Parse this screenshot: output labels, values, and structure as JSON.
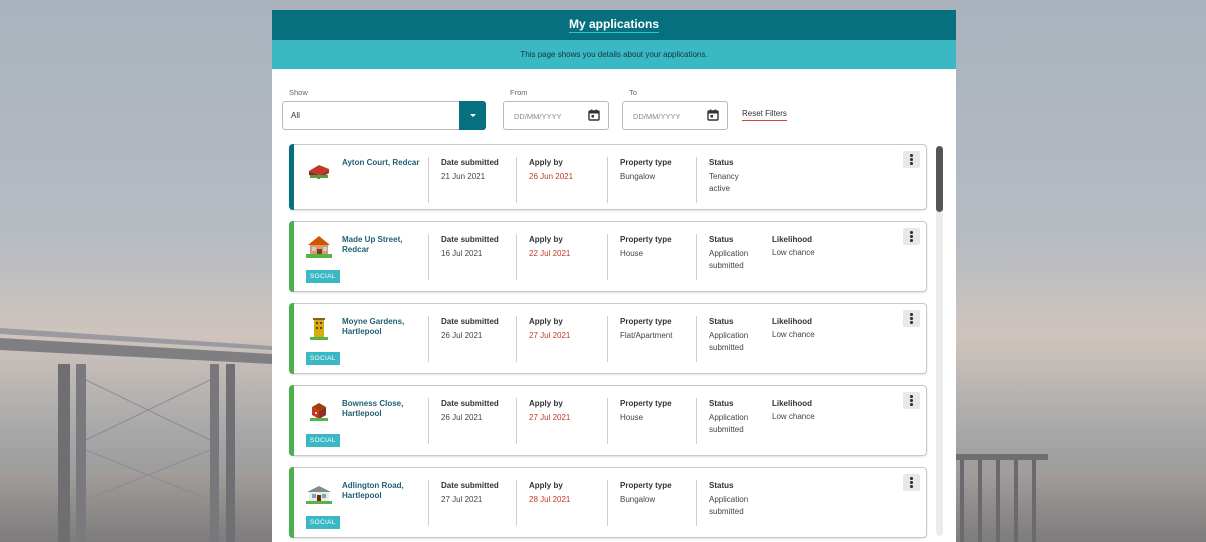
{
  "header": {
    "title": "My applications"
  },
  "subheader": {
    "text": "This page shows you details about your applications."
  },
  "filters": {
    "show_label": "Show",
    "show_value": "All",
    "from_label": "From",
    "from_placeholder": "DD/MM/YYYY",
    "to_label": "To",
    "to_placeholder": "DD/MM/YYYY",
    "reset_label": "Reset Filters"
  },
  "labels": {
    "date_submitted": "Date submitted",
    "apply_by": "Apply by",
    "property_type": "Property type",
    "status": "Status",
    "likelihood": "Likelihood",
    "social_tag": "SOCIAL"
  },
  "applications": [
    {
      "address": "Ayton Court, Redcar",
      "date_submitted": "21 Jun 2021",
      "apply_by": "26 Jun 2021",
      "property_type": "Bungalow",
      "status": "Tenancy active",
      "likelihood": "",
      "social": false,
      "accent": "#06707e"
    },
    {
      "address": "Made Up Street, Redcar",
      "date_submitted": "16 Jul 2021",
      "apply_by": "22 Jul 2021",
      "property_type": "House",
      "status": "Application submitted",
      "likelihood": "Low chance",
      "social": true,
      "accent": "#4cae4f"
    },
    {
      "address": "Moyne Gardens, Hartlepool",
      "date_submitted": "26 Jul 2021",
      "apply_by": "27 Jul 2021",
      "property_type": "Flat/Apartment",
      "status": "Application submitted",
      "likelihood": "Low chance",
      "social": true,
      "accent": "#4cae4f"
    },
    {
      "address": "Bowness Close, Hartlepool",
      "date_submitted": "26 Jul 2021",
      "apply_by": "27 Jul 2021",
      "property_type": "House",
      "status": "Application submitted",
      "likelihood": "Low chance",
      "social": true,
      "accent": "#4cae4f"
    },
    {
      "address": "Adlington Road, Hartlepool",
      "date_submitted": "27 Jul 2021",
      "apply_by": "28 Jul 2021",
      "property_type": "Bungalow",
      "status": "Application submitted",
      "likelihood": "",
      "social": true,
      "accent": "#4cae4f"
    }
  ],
  "colors": {
    "primary": "#06707e",
    "secondary": "#3ab8c4",
    "accent_green": "#4cae4f",
    "date_red": "#c0392b"
  }
}
